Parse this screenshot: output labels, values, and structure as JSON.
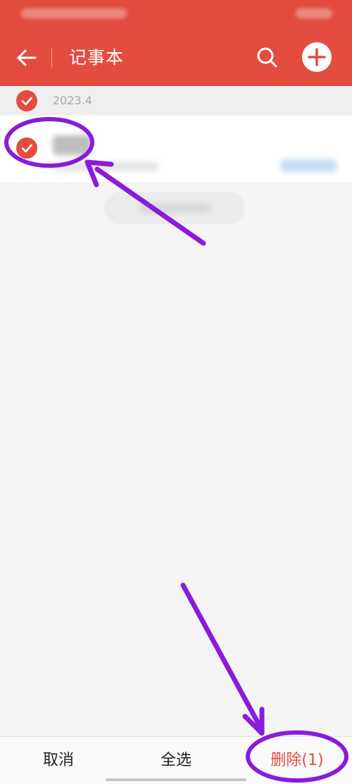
{
  "colors": {
    "accent": "#e34c3f",
    "annotation": "#8a1bdb",
    "background": "#f4f4f4"
  },
  "header": {
    "title": "记事本",
    "back_icon": "arrow-left-icon",
    "search_icon": "search-icon",
    "add_icon": "plus-icon"
  },
  "group": {
    "date": "2023.4"
  },
  "bottom_bar": {
    "cancel_label": "取消",
    "select_all_label": "全选",
    "delete_label": "删除(1)"
  }
}
